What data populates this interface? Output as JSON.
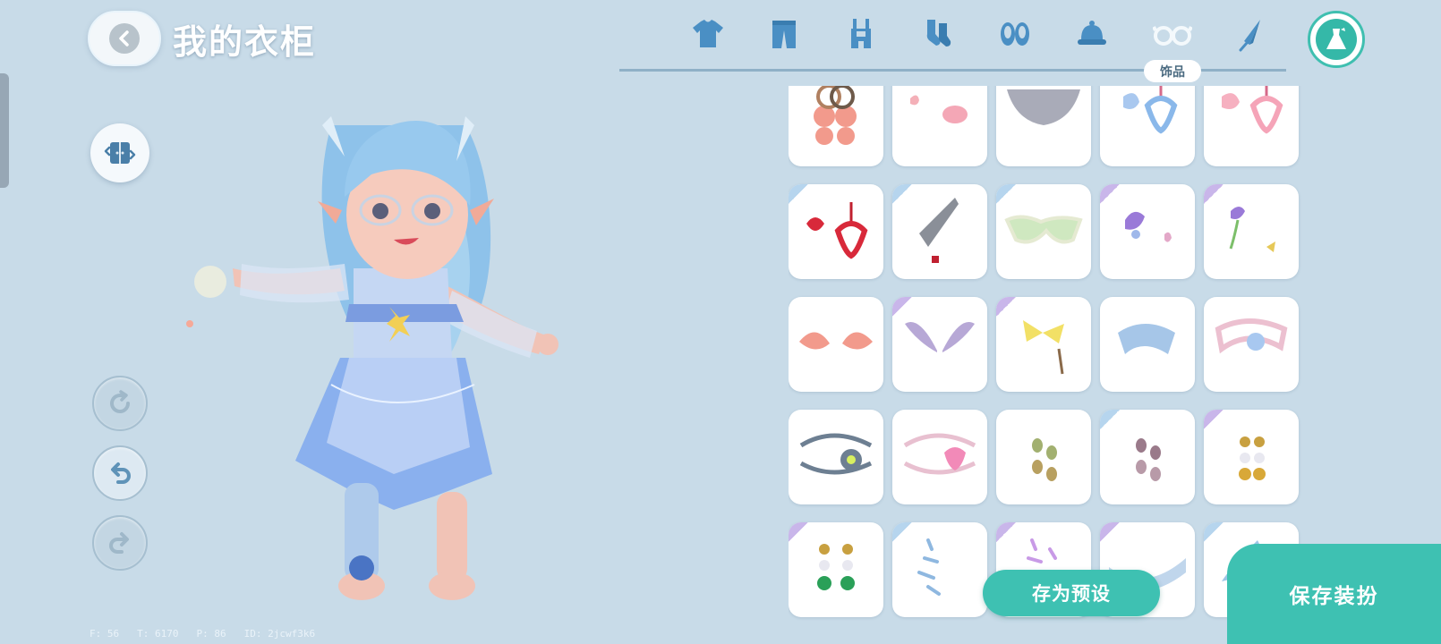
{
  "header": {
    "title": "我的衣柜",
    "back_icon": "chevron-left-icon"
  },
  "left_controls": {
    "wardrobe_icon": "wardrobe-swap-icon",
    "rotate_icon": "rotate-icon",
    "undo_icon": "undo-icon",
    "redo_icon": "redo-icon"
  },
  "categories": {
    "tabs": [
      {
        "name": "shirt-icon"
      },
      {
        "name": "pants-icon"
      },
      {
        "name": "overalls-icon"
      },
      {
        "name": "socks-icon"
      },
      {
        "name": "shoes-icon"
      },
      {
        "name": "hat-icon"
      },
      {
        "name": "glasses-icon"
      },
      {
        "name": "umbrella-icon"
      }
    ],
    "active_icon": "dress-icon",
    "active_label": "饰品"
  },
  "items": [
    {
      "name": "earring-hoops-flower",
      "tag": "none"
    },
    {
      "name": "heart-cookie-hairpin",
      "tag": "none"
    },
    {
      "name": "grey-mask",
      "tag": "none"
    },
    {
      "name": "blue-heart-earring",
      "tag": "none"
    },
    {
      "name": "pink-heart-earring",
      "tag": "none"
    },
    {
      "name": "red-heart-earring",
      "tag": "blue"
    },
    {
      "name": "feather-quill",
      "tag": "blue"
    },
    {
      "name": "green-sunglasses",
      "tag": "blue"
    },
    {
      "name": "purple-flower-pin",
      "tag": "purple"
    },
    {
      "name": "flower-bow-pin",
      "tag": "purple"
    },
    {
      "name": "elf-ears",
      "tag": "none"
    },
    {
      "name": "angel-wings",
      "tag": "purple"
    },
    {
      "name": "yellow-bow-chain",
      "tag": "purple"
    },
    {
      "name": "blue-ribbon",
      "tag": "none"
    },
    {
      "name": "pink-heart-ribbon",
      "tag": "none"
    },
    {
      "name": "grey-eyepatch",
      "tag": "none"
    },
    {
      "name": "pink-eyepatch",
      "tag": "none"
    },
    {
      "name": "green-bead-earring",
      "tag": "none"
    },
    {
      "name": "purple-bead-earring",
      "tag": "blue"
    },
    {
      "name": "gold-bead-earring",
      "tag": "purple"
    },
    {
      "name": "green-pearl-earring",
      "tag": "purple"
    },
    {
      "name": "blue-sparkle-trail",
      "tag": "blue"
    },
    {
      "name": "purple-sparkle-trail",
      "tag": "purple"
    },
    {
      "name": "lace-collar",
      "tag": "purple"
    },
    {
      "name": "feather-fan",
      "tag": "blue"
    }
  ],
  "actions": {
    "save_preset": "存为预设",
    "save_outfit": "保存装扮"
  },
  "stats": {
    "f": "F: 56",
    "t": "T: 6170",
    "p": "P: 86",
    "id": "ID: 2jcwf3k6"
  },
  "colors": {
    "background": "#c8dbe8",
    "accent": "#3ec1b2",
    "icon_blue": "#4a8fc4"
  }
}
